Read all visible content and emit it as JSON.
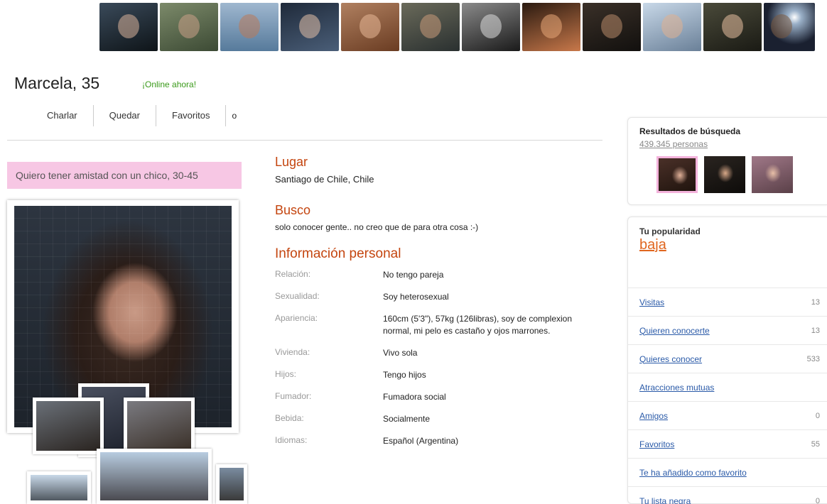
{
  "profile": {
    "name_age": "Marcela, 35",
    "online": "¡Online ahora!",
    "seeking_banner": "Quiero tener amistad con un chico, 30-45"
  },
  "actions": {
    "chat": "Charlar",
    "meet": "Quedar",
    "favorites": "Favoritos",
    "favorites_count": "o"
  },
  "location": {
    "title": "Lugar",
    "value": "Santiago de Chile, Chile"
  },
  "seeking": {
    "title": "Busco",
    "value": "solo conocer gente.. no creo que de para otra cosa :-)"
  },
  "personal": {
    "title": "Información personal",
    "rows": [
      {
        "label": "Relación:",
        "value": "No tengo pareja"
      },
      {
        "label": "Sexualidad:",
        "value": "Soy heterosexual"
      },
      {
        "label": "Apariencia:",
        "value": "160cm (5'3\"), 57kg (126libras), soy de complexion normal, mi pelo es castaño y ojos marrones."
      },
      {
        "label": "Vivienda:",
        "value": "Vivo sola"
      },
      {
        "label": "Hijos:",
        "value": "Tengo hijos"
      },
      {
        "label": "Fumador:",
        "value": "Fumadora social"
      },
      {
        "label": "Bebida:",
        "value": "Socialmente"
      },
      {
        "label": "Idiomas:",
        "value": "Español (Argentina)"
      }
    ]
  },
  "search_results": {
    "title": "Resultados de búsqueda",
    "count": "439.345 personas"
  },
  "popularity": {
    "title": "Tu popularidad",
    "level": "baja",
    "items": [
      {
        "label": "Visitas",
        "count": "13"
      },
      {
        "label": "Quieren conocerte",
        "count": "13"
      },
      {
        "label": "Quieres conocer",
        "count": "533"
      },
      {
        "label": "Atracciones mutuas",
        "count": ""
      },
      {
        "label": "Amigos",
        "count": "0"
      },
      {
        "label": "Favoritos",
        "count": "55"
      },
      {
        "label": "Te ha añadido como favorito",
        "count": ""
      },
      {
        "label": "Tu lista negra",
        "count": "0"
      }
    ]
  },
  "colors": {
    "accent_orange": "#c4450f",
    "online_green": "#3a9a1a",
    "link_blue": "#2a5aa8",
    "banner_pink": "#f7c7e4"
  }
}
